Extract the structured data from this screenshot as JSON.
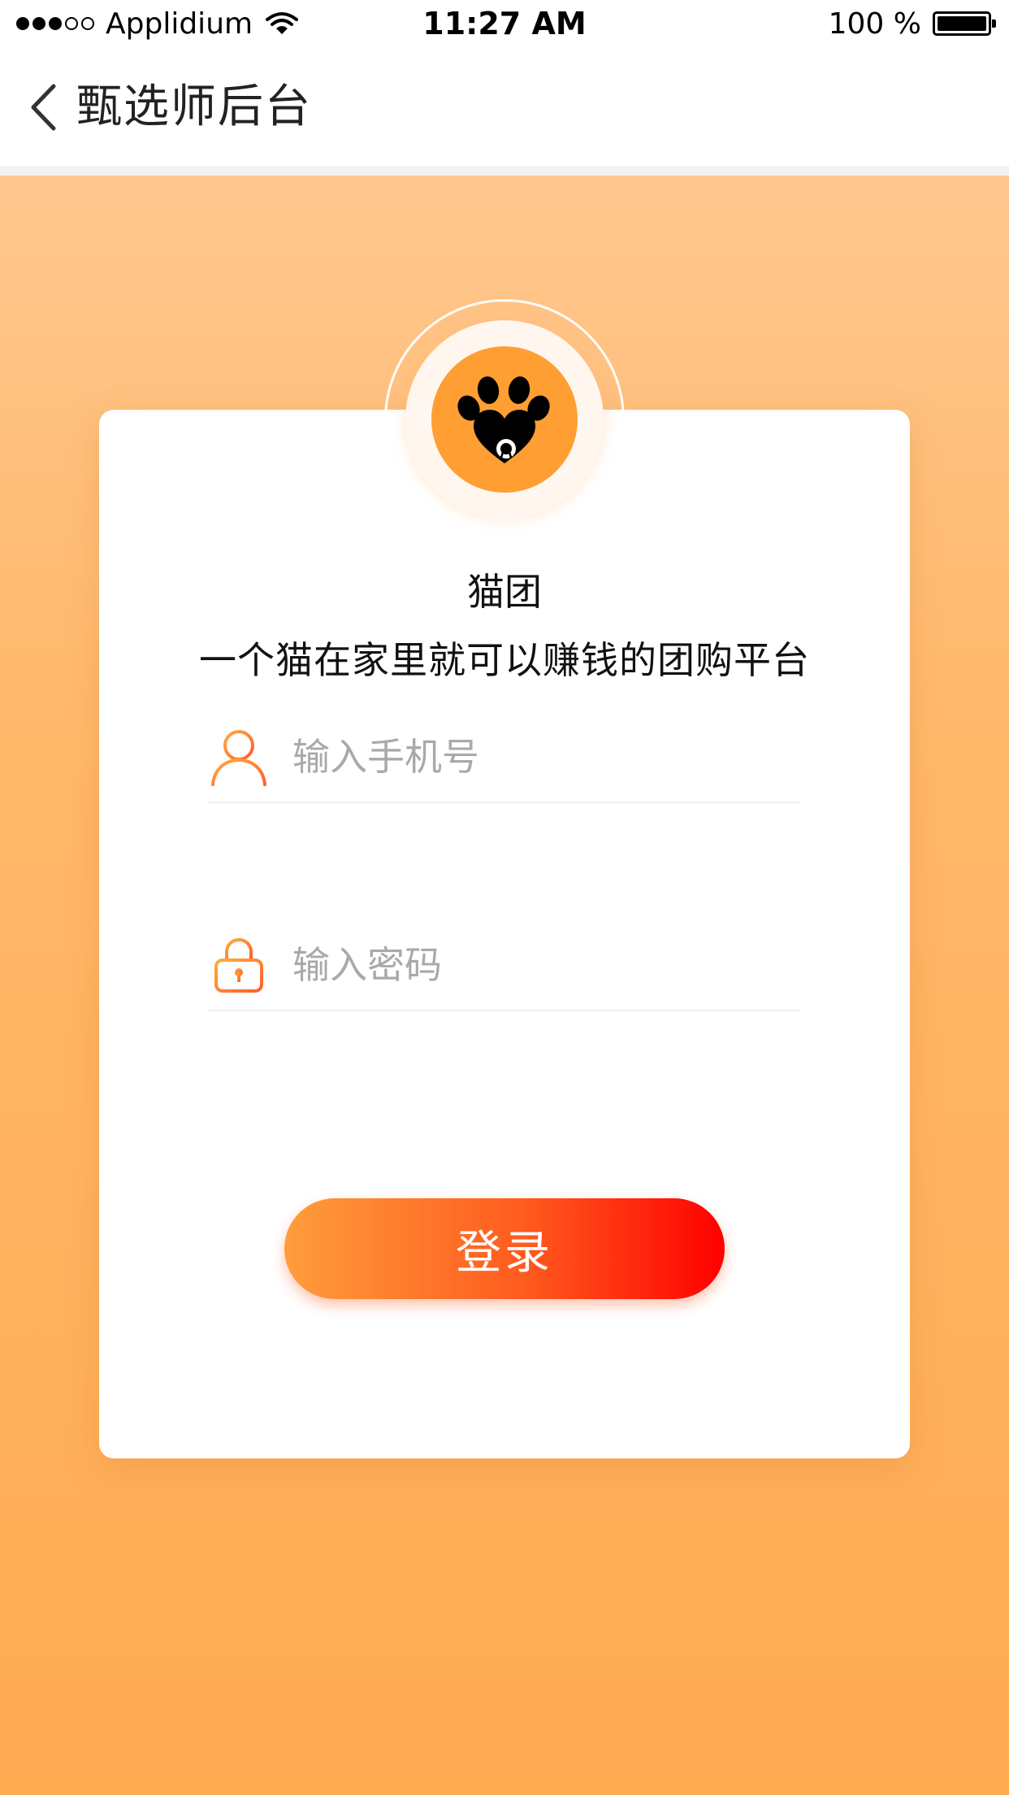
{
  "status_bar": {
    "carrier": "Applidium",
    "time": "11:27 AM",
    "battery": "100 %"
  },
  "nav": {
    "title": "甄选师后台",
    "back_icon": "chevron-left-icon"
  },
  "brand": {
    "name": "猫团",
    "tagline": "一个猫在家里就可以赚钱的团购平台",
    "logo_icon": "paw-heart-icon"
  },
  "login_form": {
    "phone": {
      "value": "",
      "placeholder": "输入手机号",
      "icon": "user-icon"
    },
    "password": {
      "value": "",
      "placeholder": "输入密码",
      "icon": "lock-icon"
    },
    "submit_label": "登录"
  },
  "colors": {
    "accent": "#ff9e33",
    "button_start": "#ff9d3c",
    "button_end": "#ff0000",
    "background_top": "#ffc78e",
    "background_bottom": "#ffab52"
  }
}
